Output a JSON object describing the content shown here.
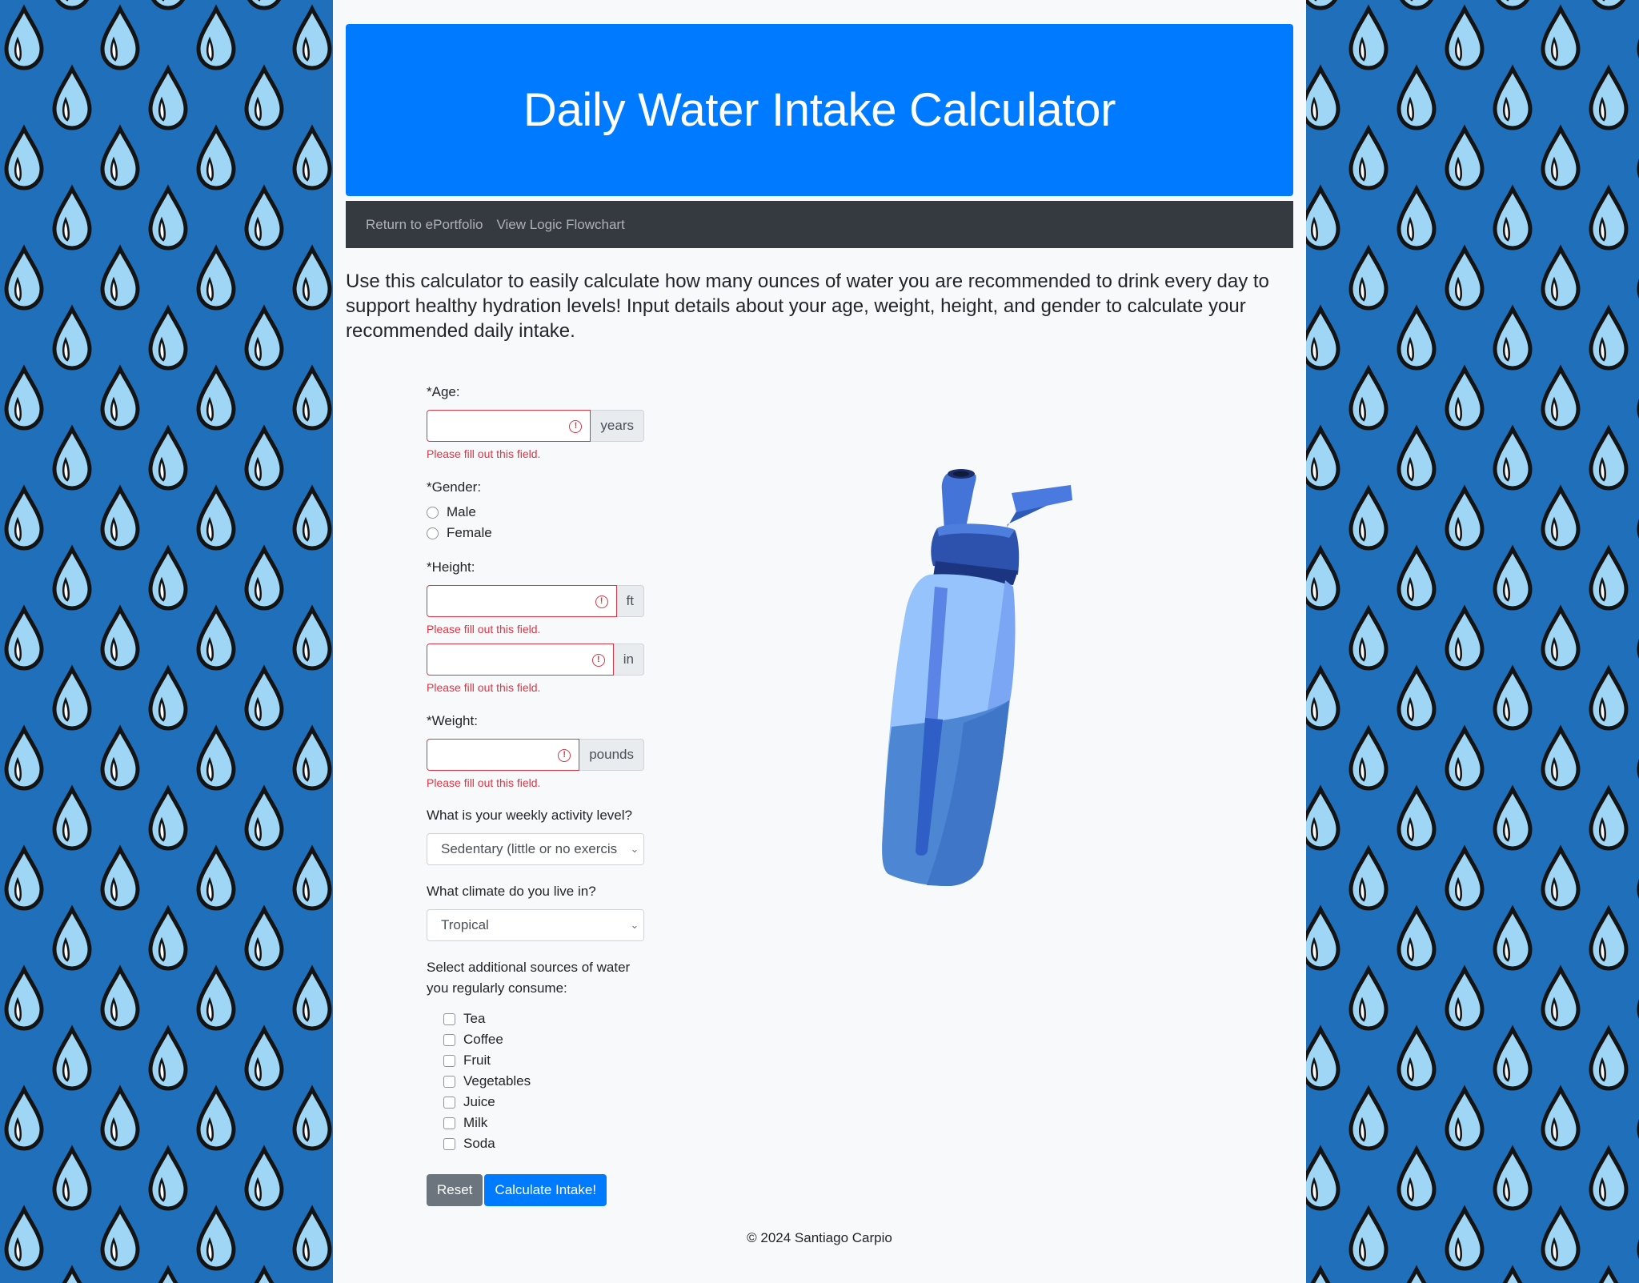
{
  "header": {
    "title": "Daily Water Intake Calculator"
  },
  "nav": {
    "items": [
      "Return to ePortfolio",
      "View Logic Flowchart"
    ]
  },
  "intro": "Use this calculator to easily calculate how many ounces of water you are recommended to drink every day to support healthy hydration levels! Input details about your age, weight, height, and gender to calculate your recommended daily intake.",
  "form": {
    "age": {
      "label": "*Age:",
      "value": "",
      "unit": "years",
      "error": "Please fill out this field."
    },
    "gender": {
      "label": "*Gender:",
      "options": [
        "Male",
        "Female"
      ]
    },
    "height": {
      "label": "*Height:",
      "feet": {
        "value": "",
        "unit": "ft",
        "error": "Please fill out this field."
      },
      "inches": {
        "value": "",
        "unit": "in",
        "error": "Please fill out this field."
      }
    },
    "weight": {
      "label": "*Weight:",
      "value": "",
      "unit": "pounds",
      "error": "Please fill out this field."
    },
    "activity": {
      "label": "What is your weekly activity level?",
      "selected": "Sedentary (little or no exercis"
    },
    "climate": {
      "label": "What climate do you live in?",
      "selected": "Tropical"
    },
    "sources": {
      "label": "Select additional sources of water you regularly consume:",
      "items": [
        "Tea",
        "Coffee",
        "Fruit",
        "Vegetables",
        "Juice",
        "Milk",
        "Soda"
      ]
    },
    "reset_label": "Reset",
    "submit_label": "Calculate Intake!"
  },
  "footer": "© 2024 Santiago Carpio",
  "colors": {
    "primary": "#007bff",
    "danger": "#dc3545",
    "navbar": "#343a40",
    "background_pattern": "#1f6fba"
  }
}
